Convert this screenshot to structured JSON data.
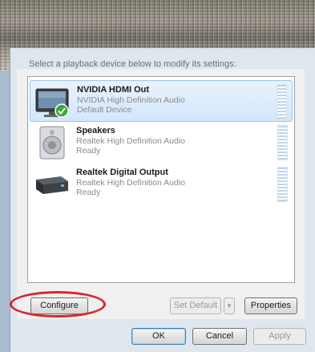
{
  "dialog": {
    "instruction": "Select a playback device below to modify its settings:"
  },
  "devices": [
    {
      "name": "NVIDIA HDMI Out",
      "driver": "NVIDIA High Definition Audio",
      "status": "Default Device",
      "icon": "monitor-icon",
      "default_badge": "checkmark-icon",
      "selected": true
    },
    {
      "name": "Speakers",
      "driver": "Realtek High Definition Audio",
      "status": "Ready",
      "icon": "speaker-icon",
      "selected": false
    },
    {
      "name": "Realtek Digital Output",
      "driver": "Realtek High Definition Audio",
      "status": "Ready",
      "icon": "digital-output-icon",
      "selected": false
    }
  ],
  "buttons": {
    "configure": "Configure",
    "set_default": "Set Default",
    "set_default_arrow": "▼",
    "properties": "Properties",
    "ok": "OK",
    "cancel": "Cancel",
    "apply": "Apply"
  },
  "colors": {
    "highlight_ring": "#d8262c",
    "selection": "#d2e6fb",
    "check": "#3aa63a"
  }
}
